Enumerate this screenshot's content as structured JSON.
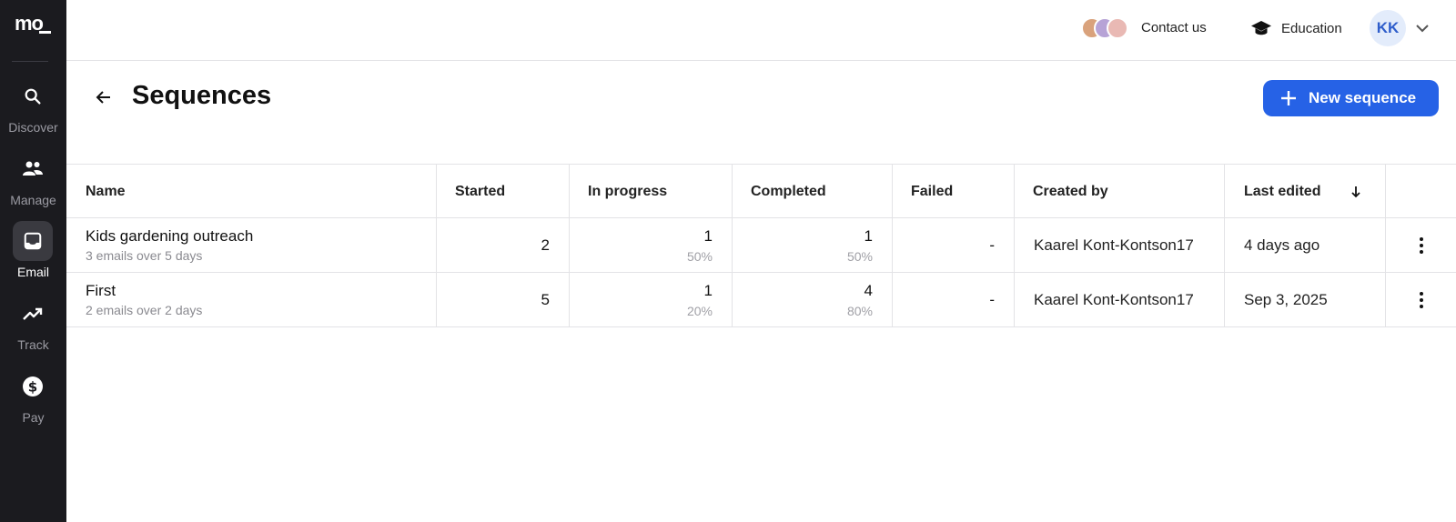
{
  "app": {
    "logo_text": "mo"
  },
  "sidebar": {
    "items": [
      {
        "label": "Discover",
        "icon": "search-icon",
        "active": false
      },
      {
        "label": "Manage",
        "icon": "people-icon",
        "active": false
      },
      {
        "label": "Email",
        "icon": "inbox-icon",
        "active": true
      },
      {
        "label": "Track",
        "icon": "trending-icon",
        "active": false
      },
      {
        "label": "Pay",
        "icon": "dollar-icon",
        "active": false
      }
    ]
  },
  "topbar": {
    "contact_label": "Contact us",
    "education_label": "Education",
    "user_initials": "KK"
  },
  "header": {
    "title": "Sequences",
    "new_button_label": "New sequence"
  },
  "table": {
    "columns": [
      "Name",
      "Started",
      "In progress",
      "Completed",
      "Failed",
      "Created by",
      "Last edited"
    ],
    "sort_column": "Last edited",
    "sort_direction": "descending",
    "rows": [
      {
        "name": "Kids gardening outreach",
        "subtitle": "3 emails over 5 days",
        "started": "2",
        "in_progress": "1",
        "in_progress_pct": "50%",
        "completed": "1",
        "completed_pct": "50%",
        "failed": "-",
        "created_by": "Kaarel Kont-Kontson17",
        "last_edited": "4 days ago"
      },
      {
        "name": "First",
        "subtitle": "2 emails over 2 days",
        "started": "5",
        "in_progress": "1",
        "in_progress_pct": "20%",
        "completed": "4",
        "completed_pct": "80%",
        "failed": "-",
        "created_by": "Kaarel Kont-Kontson17",
        "last_edited": "Sep 3, 2025"
      }
    ]
  },
  "colors": {
    "sidebar_bg": "#1b1b1f",
    "primary": "#2662e6",
    "avatar_bg": "#e3ecfb",
    "avatar_text": "#2f5ecb"
  }
}
